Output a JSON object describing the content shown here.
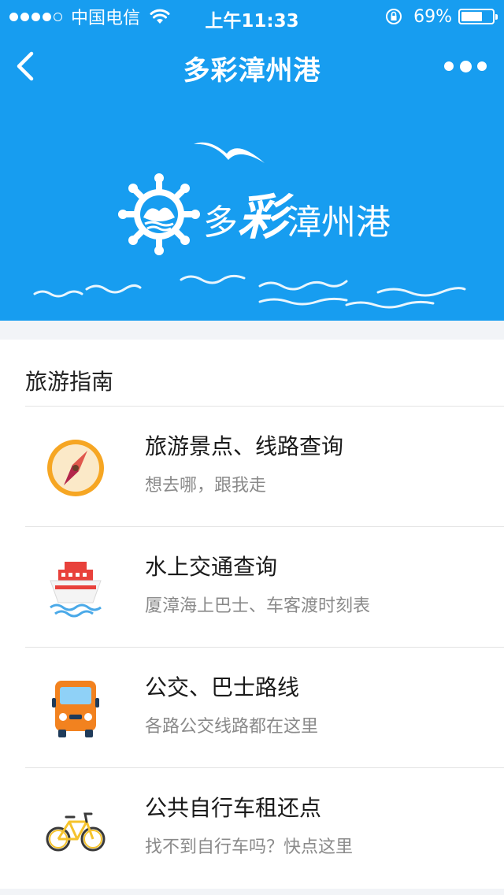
{
  "status_bar": {
    "carrier": "中国电信",
    "time": "上午11:33",
    "battery_percent": "69%",
    "battery_level": 0.69
  },
  "nav": {
    "title": "多彩漳州港"
  },
  "banner": {
    "logo_text_prefix": "多",
    "logo_text_big": "彩",
    "logo_text_suffix": "漳州港"
  },
  "section": {
    "title": "旅游指南",
    "items": [
      {
        "title": "旅游景点、线路查询",
        "subtitle": "想去哪，跟我走",
        "icon": "compass-icon"
      },
      {
        "title": "水上交通查询",
        "subtitle": "厦漳海上巴士、车客渡时刻表",
        "icon": "ferry-icon"
      },
      {
        "title": "公交、巴士路线",
        "subtitle": "各路公交线路都在这里",
        "icon": "bus-icon"
      },
      {
        "title": "公共自行车租还点",
        "subtitle": "找不到自行车吗？快点这里",
        "icon": "bicycle-icon"
      }
    ]
  },
  "colors": {
    "header_blue": "#179df0",
    "background": "#f2f4f7"
  }
}
